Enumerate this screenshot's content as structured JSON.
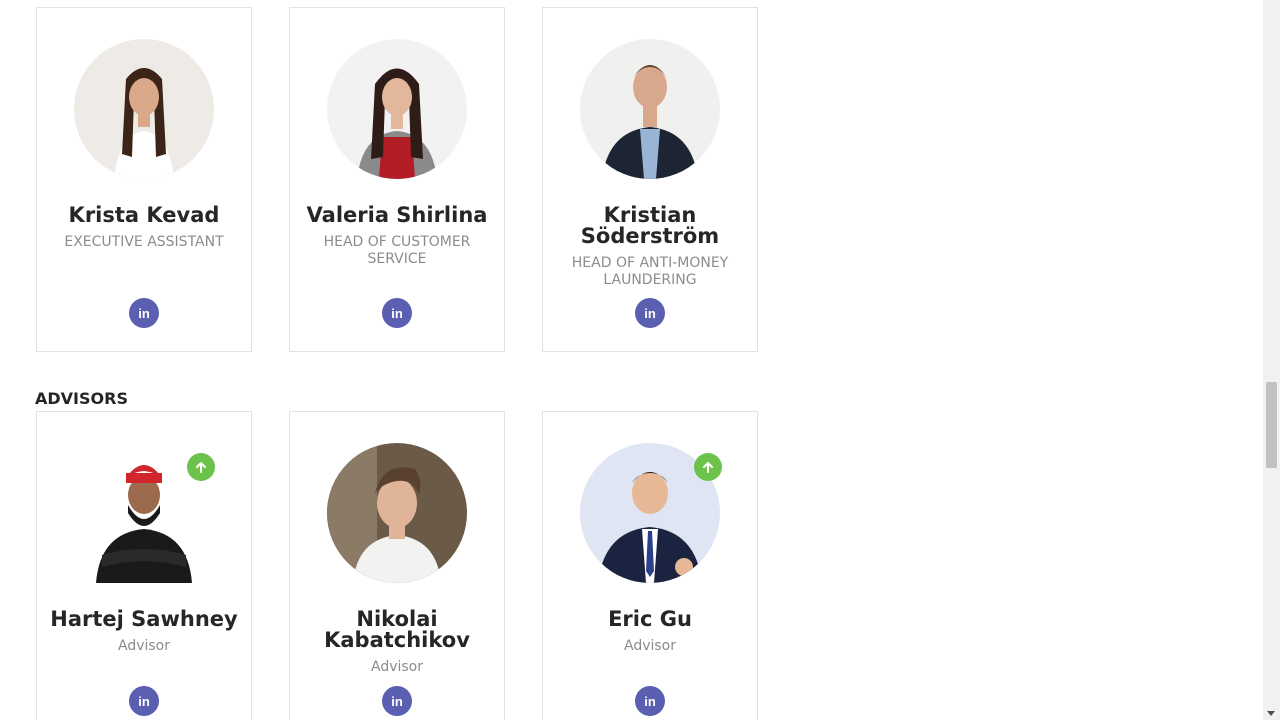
{
  "team": [
    {
      "name": "Krista Kevad",
      "role": "EXECUTIVE ASSISTANT",
      "social": "in"
    },
    {
      "name": "Valeria Shirlina",
      "role": "HEAD OF CUSTOMER SERVICE",
      "social": "in"
    },
    {
      "name": "Kristian Söderström",
      "role": "HEAD OF ANTI-MONEY LAUNDERING",
      "social": "in"
    }
  ],
  "advisors_heading": "ADVISORS",
  "advisors": [
    {
      "name": "Hartej Sawhney",
      "role": "Advisor",
      "social": "in"
    },
    {
      "name": "Nikolai Kabatchikov",
      "role": "Advisor",
      "social": "in"
    },
    {
      "name": "Eric Gu",
      "role": "Advisor",
      "social": "in"
    }
  ],
  "colors": {
    "linkedin_badge": "#5a5fb1",
    "up_badge": "#6cc24a",
    "card_border": "#e2e2e2",
    "name_text": "#262626",
    "role_text": "#8c8c8c"
  },
  "icons": {
    "social": "linkedin-icon",
    "badge": "arrow-up-icon"
  }
}
